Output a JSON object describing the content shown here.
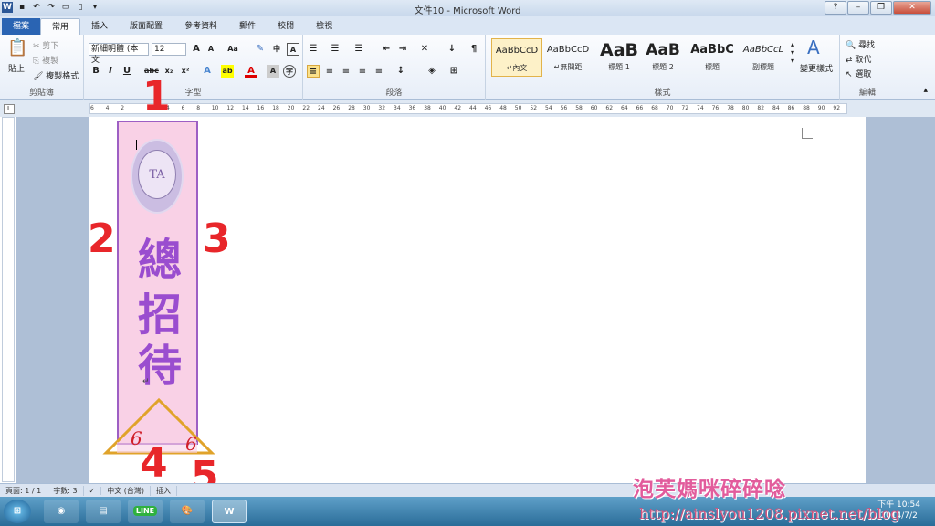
{
  "window": {
    "title": "文件10 - Microsoft Word"
  },
  "tabs": [
    "檔案",
    "常用",
    "插入",
    "版面配置",
    "參考資料",
    "郵件",
    "校閱",
    "檢視"
  ],
  "clipboard": {
    "paste": "貼上",
    "cut": "剪下",
    "copy": "複製",
    "format_painter": "複製格式",
    "label": "剪貼簿"
  },
  "font": {
    "name": "新細明體 (本文",
    "size": "12",
    "label": "字型"
  },
  "paragraph": {
    "label": "段落"
  },
  "styles": {
    "items": [
      {
        "preview": "AaBbCcD",
        "name": "↵內文"
      },
      {
        "preview": "AaBbCcD",
        "name": "↵無間距"
      },
      {
        "preview": "AaB",
        "name": "標題 1"
      },
      {
        "preview": "AaB",
        "name": "標題 2"
      },
      {
        "preview": "AaBbC",
        "name": "標題"
      },
      {
        "preview": "AaBbCcL",
        "name": "副標題"
      }
    ],
    "change": "變更樣式",
    "label": "樣式"
  },
  "editing": {
    "find": "尋找",
    "replace": "取代",
    "select": "選取",
    "label": "編輯"
  },
  "ruler_ticks": [
    "6",
    "4",
    "2",
    "",
    "2",
    "4",
    "6",
    "8",
    "10",
    "12",
    "14",
    "16",
    "18",
    "20",
    "22",
    "24",
    "26",
    "28",
    "30",
    "32",
    "34",
    "36",
    "38",
    "40",
    "42",
    "44",
    "46",
    "48",
    "50",
    "52",
    "54",
    "56",
    "58",
    "60",
    "62",
    "64",
    "66",
    "68",
    "70",
    "72",
    "74",
    "76",
    "78",
    "80",
    "82",
    "84",
    "86",
    "88",
    "90",
    "92"
  ],
  "document": {
    "banner_chars": [
      "總",
      "招",
      "待"
    ],
    "seal_text": "TA",
    "para_mark": "↵"
  },
  "annotations": [
    "1",
    "2",
    "3",
    "4",
    "5",
    "6",
    "6"
  ],
  "status": {
    "page": "頁面: 1 / 1",
    "words": "字數: 3",
    "lang": "中文 (台灣)",
    "mode": "插入"
  },
  "taskbar": {
    "time": "下午 10:54",
    "date": "2014/7/2",
    "line": "LINE"
  },
  "watermark": {
    "name": "泡芙媽咪碎碎唸",
    "url": "http://ainslyou1208.pixnet.net/blog"
  },
  "colors": {
    "banner_fill": "#f9d1e6",
    "banner_border": "#9d5fc4",
    "annotation": "#e8262a",
    "triangle": "#e0a32a"
  }
}
